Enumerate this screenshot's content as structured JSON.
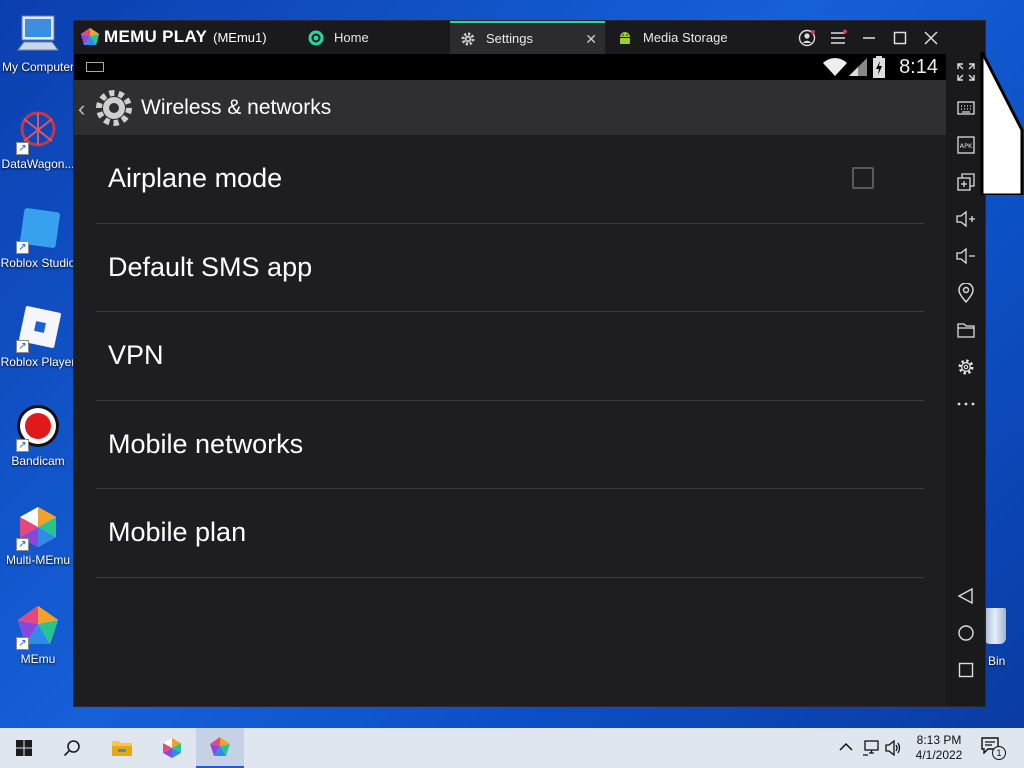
{
  "desktop": {
    "icons": [
      {
        "label": "My Computer",
        "icon": "computer-icon"
      },
      {
        "label": "DataWagon...",
        "icon": "datawagon-icon"
      },
      {
        "label": "Roblox Studio",
        "icon": "roblox-studio-icon"
      },
      {
        "label": "Roblox Player",
        "icon": "roblox-player-icon"
      },
      {
        "label": "Bandicam",
        "icon": "bandicam-icon"
      },
      {
        "label": "Multi-MEmu",
        "icon": "multi-memu-icon"
      },
      {
        "label": "MEmu",
        "icon": "memu-icon"
      }
    ],
    "recycle_bin_label": "Bin"
  },
  "emulator": {
    "brand": "MEMU PLAY",
    "instance": "(MEmu1)",
    "tabs": [
      {
        "label": "Home",
        "icon": "memu-home-icon",
        "active": false
      },
      {
        "label": "Settings",
        "icon": "gear-icon",
        "active": true
      },
      {
        "label": "Media Storage",
        "icon": "android-icon",
        "active": false
      }
    ],
    "window_buttons": [
      "account-icon",
      "menu-icon",
      "minimize-icon",
      "maximize-icon",
      "close-icon",
      "collapse-toolbar-icon"
    ],
    "accent": "#2ed3a0"
  },
  "android": {
    "status": {
      "time": "8:14",
      "icons": [
        "wifi-icon",
        "signal-icon",
        "battery-icon"
      ]
    },
    "action_bar": {
      "title": "Wireless & networks"
    },
    "settings": [
      {
        "label": "Airplane mode",
        "has_checkbox": true,
        "checked": false
      },
      {
        "label": "Default SMS app"
      },
      {
        "label": "VPN"
      },
      {
        "label": "Mobile networks"
      },
      {
        "label": "Mobile plan"
      }
    ]
  },
  "toolbar": [
    "fullscreen-icon",
    "keyboard-icon",
    "apk-icon",
    "multi-window-icon",
    "volume-up-icon",
    "volume-down-icon",
    "location-icon",
    "folder-icon",
    "settings-icon",
    "more-icon",
    "back-nav-icon",
    "home-nav-icon",
    "recents-nav-icon"
  ],
  "taskbar": {
    "apps": [
      "windows-start-icon",
      "search-icon",
      "file-explorer-icon",
      "multi-memu-icon",
      "memu-icon"
    ],
    "tray_icons": [
      "chevron-up-icon",
      "network-icon",
      "speaker-icon"
    ],
    "time": "8:13 PM",
    "date": "4/1/2022",
    "notification_count": "1"
  }
}
